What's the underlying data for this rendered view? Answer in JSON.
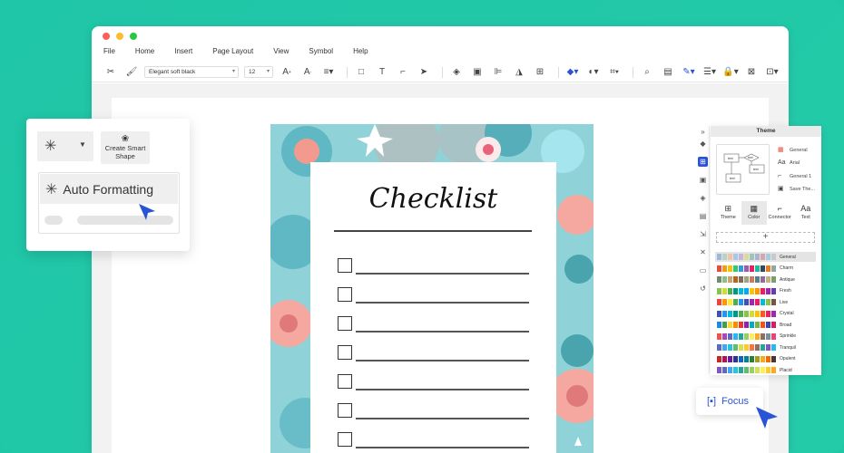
{
  "menu": [
    "File",
    "Home",
    "Insert",
    "Page Layout",
    "View",
    "Symbol",
    "Help"
  ],
  "toolbar": {
    "font_value": "Elegant soft black",
    "size_value": "12"
  },
  "left_panel": {
    "smart_shape_label": "Create Smart Shape",
    "auto_format_label": "Auto Formatting"
  },
  "checklist": {
    "title": "Checklist",
    "rows": 7
  },
  "theme_panel": {
    "title": "Theme",
    "options": [
      "General",
      "Arial",
      "General 1",
      "Save The..."
    ],
    "tabs": [
      "Theme",
      "Color",
      "Connector",
      "Text"
    ],
    "active_tab": "Color",
    "preview_labels": [
      "text",
      "text",
      "text",
      "text"
    ],
    "themes": [
      {
        "name": "General",
        "colors": [
          "#9fb8d8",
          "#b7d3c8",
          "#f0c4a4",
          "#a9c6e6",
          "#c8b4d8",
          "#d9d9a0",
          "#9ec6b6",
          "#b0b0d0",
          "#d4a8a8",
          "#a4cce0",
          "#c9c9c9"
        ]
      },
      {
        "name": "Charm",
        "colors": [
          "#e84c3d",
          "#f39c12",
          "#f1c40f",
          "#2ecc71",
          "#3498db",
          "#9b59b6",
          "#e91e63",
          "#1abc9c",
          "#34495e",
          "#e67e22",
          "#95a5a6"
        ]
      },
      {
        "name": "Antique",
        "colors": [
          "#6a8f6a",
          "#8fbc8f",
          "#c9a66b",
          "#b5651d",
          "#7d6d5d",
          "#a3a380",
          "#c97d60",
          "#5d7d8d",
          "#8d6d9d",
          "#c2b280",
          "#7d9d6d"
        ]
      },
      {
        "name": "Fresh",
        "colors": [
          "#8bc34a",
          "#cddc39",
          "#4caf50",
          "#009688",
          "#00bcd4",
          "#03a9f4",
          "#ffc107",
          "#ff9800",
          "#e91e63",
          "#9c27b0",
          "#673ab7"
        ]
      },
      {
        "name": "Live",
        "colors": [
          "#f44336",
          "#ff9800",
          "#ffeb3b",
          "#4caf50",
          "#2196f3",
          "#3f51b5",
          "#9c27b0",
          "#e91e63",
          "#00bcd4",
          "#8bc34a",
          "#795548"
        ]
      },
      {
        "name": "Crystal",
        "colors": [
          "#3f51b5",
          "#2196f3",
          "#00bcd4",
          "#009688",
          "#4caf50",
          "#8bc34a",
          "#cddc39",
          "#ffc107",
          "#ff5722",
          "#e91e63",
          "#9c27b0"
        ]
      },
      {
        "name": "Broad",
        "colors": [
          "#1e88e5",
          "#43a047",
          "#fdd835",
          "#fb8c00",
          "#e53935",
          "#8e24aa",
          "#00acc1",
          "#7cb342",
          "#f4511e",
          "#3949ab",
          "#d81b60"
        ]
      },
      {
        "name": "Sprinkle",
        "colors": [
          "#ef5350",
          "#ab47bc",
          "#5c6bc0",
          "#29b6f6",
          "#26a69a",
          "#9ccc65",
          "#ffee58",
          "#ffa726",
          "#8d6e63",
          "#78909c",
          "#ec407a"
        ]
      },
      {
        "name": "Tranquil",
        "colors": [
          "#5c6bc0",
          "#42a5f5",
          "#26c6da",
          "#66bb6a",
          "#d4e157",
          "#ffca28",
          "#ff7043",
          "#8d6e63",
          "#26a69a",
          "#7e57c2",
          "#29b6f6"
        ]
      },
      {
        "name": "Opulent",
        "colors": [
          "#c62828",
          "#ad1457",
          "#6a1b9a",
          "#283593",
          "#1565c0",
          "#00838f",
          "#2e7d32",
          "#9e9d24",
          "#f9a825",
          "#ef6c00",
          "#4e342e"
        ]
      },
      {
        "name": "Placid",
        "colors": [
          "#7e57c2",
          "#5c6bc0",
          "#42a5f5",
          "#26c6da",
          "#26a69a",
          "#66bb6a",
          "#9ccc65",
          "#d4e157",
          "#ffee58",
          "#ffca28",
          "#ffa726"
        ]
      }
    ]
  },
  "focus": {
    "label": "Focus"
  },
  "colors": {
    "background": "#1fc7a6",
    "accent": "#2a54d6",
    "sheet": "#8fd3d8"
  }
}
